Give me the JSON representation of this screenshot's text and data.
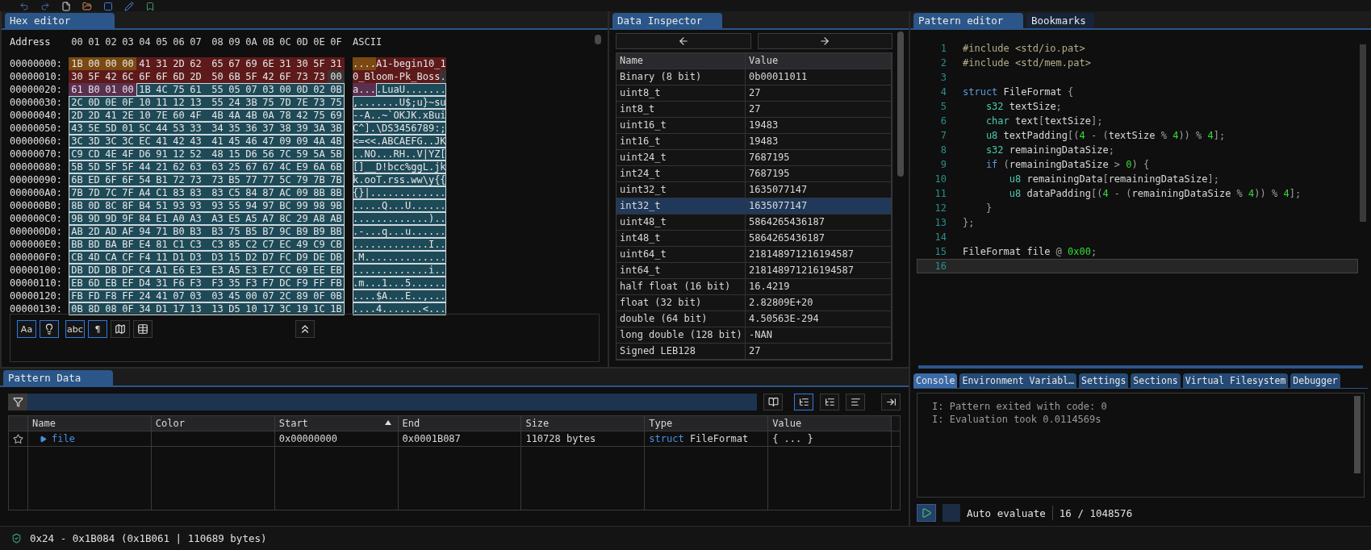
{
  "toolbar": {
    "icons": [
      {
        "kind": "undo"
      },
      {
        "kind": "redo"
      },
      {
        "kind": "file"
      },
      {
        "kind": "folder"
      },
      {
        "kind": "square"
      },
      {
        "kind": "pencil"
      },
      {
        "kind": "bookmark"
      }
    ]
  },
  "hex_editor": {
    "tabs": [
      {
        "label": "Hex editor",
        "selected": true
      }
    ],
    "header": {
      "address": "Address",
      "columns": [
        "00",
        "01",
        "02",
        "03",
        "04",
        "05",
        "06",
        "07",
        "08",
        "09",
        "0A",
        "0B",
        "0C",
        "0D",
        "0E",
        "0F"
      ],
      "ascii": "ASCII"
    },
    "rows": [
      {
        "address": "00000000:",
        "groups": [
          {
            "color": "#7a4a12",
            "selected": false,
            "bytes": [
              "1B",
              "00",
              "00",
              "00"
            ],
            "ascii": "...."
          },
          {
            "color": "#5e1a1a",
            "selected": false,
            "bytes": [
              "41",
              "31",
              "2D",
              "62",
              "65",
              "67",
              "69",
              "6E",
              "31",
              "30",
              "5F",
              "31"
            ],
            "ascii": "A1-begin10_1"
          }
        ]
      },
      {
        "address": "00000010:",
        "groups": [
          {
            "color": "#5e1a1a",
            "selected": false,
            "bytes": [
              "30",
              "5F",
              "42",
              "6C",
              "6F",
              "6F",
              "6D",
              "2D",
              "50",
              "6B",
              "5F",
              "42",
              "6F",
              "73",
              "73"
            ],
            "ascii": "0_Bloom-Pk_Boss"
          },
          {
            "color": "#3a3434",
            "selected": false,
            "bytes": [
              "00"
            ],
            "ascii": "."
          }
        ]
      },
      {
        "address": "00000020:",
        "groups": [
          {
            "color": "#5a3050",
            "selected": false,
            "bytes": [
              "61",
              "B0",
              "01",
              "00"
            ],
            "ascii": "a..."
          },
          {
            "color": "#1e4a58",
            "selected": true,
            "bytes": [
              "1B",
              "4C",
              "75",
              "61",
              "55",
              "05",
              "07",
              "03",
              "00",
              "0D",
              "02",
              "0B"
            ],
            "ascii": ".LuaU......."
          }
        ]
      },
      {
        "address": "00000030:",
        "groups": [
          {
            "color": "#1e4a58",
            "selected": true,
            "bytes": [
              "2C",
              "0D",
              "0E",
              "0F",
              "10",
              "11",
              "12",
              "13",
              "55",
              "24",
              "3B",
              "75",
              "7D",
              "7E",
              "73",
              "75"
            ],
            "ascii": ",.......U$;u}~su"
          }
        ]
      },
      {
        "address": "00000040:",
        "groups": [
          {
            "color": "#1e4a58",
            "selected": true,
            "bytes": [
              "2D",
              "2D",
              "41",
              "2E",
              "10",
              "7E",
              "60",
              "4F",
              "4B",
              "4A",
              "4B",
              "0A",
              "78",
              "42",
              "75",
              "69"
            ],
            "ascii": "--A..~`OKJK.xBui"
          }
        ]
      },
      {
        "address": "00000050:",
        "groups": [
          {
            "color": "#1e4a58",
            "selected": true,
            "bytes": [
              "43",
              "5E",
              "5D",
              "01",
              "5C",
              "44",
              "53",
              "33",
              "34",
              "35",
              "36",
              "37",
              "38",
              "39",
              "3A",
              "3B"
            ],
            "ascii": "C^].\\DS3456789:;"
          }
        ]
      },
      {
        "address": "00000060:",
        "groups": [
          {
            "color": "#1e4a58",
            "selected": true,
            "bytes": [
              "3C",
              "3D",
              "3C",
              "3C",
              "EC",
              "41",
              "42",
              "43",
              "41",
              "45",
              "46",
              "47",
              "09",
              "09",
              "4A",
              "4B"
            ],
            "ascii": "<=<<.ABCAEFG..JK"
          }
        ]
      },
      {
        "address": "00000070:",
        "groups": [
          {
            "color": "#1e4a58",
            "selected": true,
            "bytes": [
              "C9",
              "CD",
              "4E",
              "4F",
              "D6",
              "91",
              "12",
              "52",
              "48",
              "15",
              "D6",
              "56",
              "7C",
              "59",
              "5A",
              "5B"
            ],
            "ascii": "..NO...RH..V|YZ["
          }
        ]
      },
      {
        "address": "00000080:",
        "groups": [
          {
            "color": "#1e4a58",
            "selected": true,
            "bytes": [
              "5B",
              "5D",
              "5F",
              "5F",
              "44",
              "21",
              "62",
              "63",
              "63",
              "25",
              "67",
              "67",
              "4C",
              "E9",
              "6A",
              "6B"
            ],
            "ascii": "[]__D!bcc%ggL.jk"
          }
        ]
      },
      {
        "address": "00000090:",
        "groups": [
          {
            "color": "#1e4a58",
            "selected": true,
            "bytes": [
              "6B",
              "ED",
              "6F",
              "6F",
              "54",
              "B1",
              "72",
              "73",
              "73",
              "B5",
              "77",
              "77",
              "5C",
              "79",
              "7B",
              "7B"
            ],
            "ascii": "k.ooT.rss.ww\\y{{"
          }
        ]
      },
      {
        "address": "000000A0:",
        "groups": [
          {
            "color": "#1e4a58",
            "selected": true,
            "bytes": [
              "7B",
              "7D",
              "7C",
              "7F",
              "A4",
              "C1",
              "83",
              "83",
              "83",
              "C5",
              "84",
              "87",
              "AC",
              "09",
              "8B",
              "8B"
            ],
            "ascii": "{}|............."
          }
        ]
      },
      {
        "address": "000000B0:",
        "groups": [
          {
            "color": "#1e4a58",
            "selected": true,
            "bytes": [
              "8B",
              "0D",
              "8C",
              "8F",
              "B4",
              "51",
              "93",
              "93",
              "93",
              "55",
              "94",
              "97",
              "BC",
              "99",
              "98",
              "9B"
            ],
            "ascii": ".....Q...U......"
          }
        ]
      },
      {
        "address": "000000C0:",
        "groups": [
          {
            "color": "#1e4a58",
            "selected": true,
            "bytes": [
              "9B",
              "9D",
              "9D",
              "9F",
              "84",
              "E1",
              "A0",
              "A3",
              "A3",
              "E5",
              "A5",
              "A7",
              "8C",
              "29",
              "A8",
              "AB"
            ],
            "ascii": ".............).."
          }
        ]
      },
      {
        "address": "000000D0:",
        "groups": [
          {
            "color": "#1e4a58",
            "selected": true,
            "bytes": [
              "AB",
              "2D",
              "AD",
              "AF",
              "94",
              "71",
              "B0",
              "B3",
              "B3",
              "75",
              "B5",
              "B7",
              "9C",
              "B9",
              "B9",
              "BB"
            ],
            "ascii": ".-...q...u......"
          }
        ]
      },
      {
        "address": "000000E0:",
        "groups": [
          {
            "color": "#1e4a58",
            "selected": true,
            "bytes": [
              "BB",
              "BD",
              "BA",
              "BF",
              "E4",
              "81",
              "C1",
              "C3",
              "C3",
              "85",
              "C2",
              "C7",
              "EC",
              "49",
              "C9",
              "CB"
            ],
            "ascii": ".............I.."
          }
        ]
      },
      {
        "address": "000000F0:",
        "groups": [
          {
            "color": "#1e4a58",
            "selected": true,
            "bytes": [
              "CB",
              "4D",
              "CA",
              "CF",
              "F4",
              "11",
              "D1",
              "D3",
              "D3",
              "15",
              "D2",
              "D7",
              "FC",
              "D9",
              "DE",
              "DB"
            ],
            "ascii": ".M.............."
          }
        ]
      },
      {
        "address": "00000100:",
        "groups": [
          {
            "color": "#1e4a58",
            "selected": true,
            "bytes": [
              "DB",
              "DD",
              "DB",
              "DF",
              "C4",
              "A1",
              "E6",
              "E3",
              "E3",
              "A5",
              "E3",
              "E7",
              "CC",
              "69",
              "EE",
              "EB"
            ],
            "ascii": ".............i.."
          }
        ]
      },
      {
        "address": "00000110:",
        "groups": [
          {
            "color": "#1e4a58",
            "selected": true,
            "bytes": [
              "EB",
              "6D",
              "EB",
              "EF",
              "D4",
              "31",
              "F6",
              "F3",
              "F3",
              "35",
              "F3",
              "F7",
              "DC",
              "F9",
              "FF",
              "FB"
            ],
            "ascii": ".m...1...5......"
          }
        ]
      },
      {
        "address": "00000120:",
        "groups": [
          {
            "color": "#1e4a58",
            "selected": true,
            "bytes": [
              "FB",
              "FD",
              "F8",
              "FF",
              "24",
              "41",
              "07",
              "03",
              "03",
              "45",
              "00",
              "07",
              "2C",
              "89",
              "0F",
              "0B"
            ],
            "ascii": "....$A...E..,..."
          }
        ]
      },
      {
        "address": "00000130:",
        "groups": [
          {
            "color": "#1e4a58",
            "selected": true,
            "bytes": [
              "0B",
              "8D",
              "08",
              "0F",
              "34",
              "D1",
              "17",
              "13",
              "13",
              "D5",
              "10",
              "17",
              "3C",
              "19",
              "1C",
              "1B"
            ],
            "ascii": "....4.......<..."
          }
        ]
      }
    ],
    "tools": [
      {
        "kind": "text",
        "label": "Aa",
        "selected": true
      },
      {
        "kind": "bulb",
        "selected": true
      },
      {
        "kind": "text",
        "label": "abc",
        "selected": true
      },
      {
        "kind": "text",
        "label": "¶",
        "selected": true
      },
      {
        "kind": "map",
        "selected": false
      },
      {
        "kind": "table",
        "selected": false
      }
    ]
  },
  "data_inspector": {
    "tabs": [
      {
        "label": "Data Inspector",
        "selected": true
      }
    ],
    "columns": [
      "Name",
      "Value"
    ],
    "rows": [
      {
        "name": "Binary (8 bit)",
        "value": "0b00011011",
        "selected": false
      },
      {
        "name": "uint8_t",
        "value": "27",
        "selected": false
      },
      {
        "name": "int8_t",
        "value": "27",
        "selected": false
      },
      {
        "name": "uint16_t",
        "value": "19483",
        "selected": false
      },
      {
        "name": "int16_t",
        "value": "19483",
        "selected": false
      },
      {
        "name": "uint24_t",
        "value": "7687195",
        "selected": false
      },
      {
        "name": "int24_t",
        "value": "7687195",
        "selected": false
      },
      {
        "name": "uint32_t",
        "value": "1635077147",
        "selected": false
      },
      {
        "name": "int32_t",
        "value": "1635077147",
        "selected": true
      },
      {
        "name": "uint48_t",
        "value": "5864265436187",
        "selected": false
      },
      {
        "name": "int48_t",
        "value": "5864265436187",
        "selected": false
      },
      {
        "name": "uint64_t",
        "value": "218148971216194587",
        "selected": false
      },
      {
        "name": "int64_t",
        "value": "218148971216194587",
        "selected": false
      },
      {
        "name": "half float (16 bit)",
        "value": "16.4219",
        "selected": false
      },
      {
        "name": "float (32 bit)",
        "value": "2.82809E+20",
        "selected": false
      },
      {
        "name": "double (64 bit)",
        "value": "4.50563E-294",
        "selected": false
      },
      {
        "name": "long double (128 bit)",
        "value": "-NAN",
        "selected": false
      },
      {
        "name": "Signed LEB128",
        "value": "27",
        "selected": false
      }
    ]
  },
  "pattern_editor": {
    "tabs": [
      {
        "label": "Pattern editor",
        "selected": true
      },
      {
        "label": "Bookmarks",
        "selected": false
      }
    ],
    "lines": [
      {
        "number": "1",
        "current": false,
        "tokens": [
          {
            "kind": "preproc",
            "text": "#include <std/io.pat>"
          }
        ]
      },
      {
        "number": "2",
        "current": false,
        "tokens": [
          {
            "kind": "preproc",
            "text": "#include <std/mem.pat>"
          }
        ]
      },
      {
        "number": "3",
        "current": false
      },
      {
        "number": "4",
        "current": false,
        "tokens": [
          {
            "kind": "keyword",
            "text": "struct"
          },
          {
            "kind": "plain",
            "text": " FileFormat "
          },
          {
            "kind": "punct",
            "text": "{"
          }
        ]
      },
      {
        "number": "5",
        "current": false,
        "tokens": [
          {
            "kind": "type",
            "text": "    s32"
          },
          {
            "kind": "plain",
            "text": " textSize"
          },
          {
            "kind": "punct",
            "text": ";"
          }
        ]
      },
      {
        "number": "6",
        "current": false,
        "tokens": [
          {
            "kind": "type",
            "text": "    char"
          },
          {
            "kind": "plain",
            "text": " text"
          },
          {
            "kind": "punct",
            "text": "["
          },
          {
            "kind": "plain",
            "text": "textSize"
          },
          {
            "kind": "punct",
            "text": "];"
          }
        ]
      },
      {
        "number": "7",
        "current": false,
        "tokens": [
          {
            "kind": "type",
            "text": "    u8"
          },
          {
            "kind": "plain",
            "text": " textPadding"
          },
          {
            "kind": "punct",
            "text": "[("
          },
          {
            "kind": "number",
            "text": "4"
          },
          {
            "kind": "punct",
            "text": " - ("
          },
          {
            "kind": "plain",
            "text": "textSize"
          },
          {
            "kind": "punct",
            "text": " % "
          },
          {
            "kind": "number",
            "text": "4"
          },
          {
            "kind": "punct",
            "text": ")) % "
          },
          {
            "kind": "number",
            "text": "4"
          },
          {
            "kind": "punct",
            "text": "];"
          }
        ]
      },
      {
        "number": "8",
        "current": false,
        "tokens": [
          {
            "kind": "type",
            "text": "    s32"
          },
          {
            "kind": "plain",
            "text": " remainingDataSize"
          },
          {
            "kind": "punct",
            "text": ";"
          }
        ]
      },
      {
        "number": "9",
        "current": false,
        "tokens": [
          {
            "kind": "keyword",
            "text": "    if"
          },
          {
            "kind": "punct",
            "text": " ("
          },
          {
            "kind": "plain",
            "text": "remainingDataSize"
          },
          {
            "kind": "punct",
            "text": " > "
          },
          {
            "kind": "number",
            "text": "0"
          },
          {
            "kind": "punct",
            "text": ") {"
          }
        ]
      },
      {
        "number": "10",
        "current": false,
        "tokens": [
          {
            "kind": "type",
            "text": "        u8"
          },
          {
            "kind": "plain",
            "text": " remainingData"
          },
          {
            "kind": "punct",
            "text": "["
          },
          {
            "kind": "plain",
            "text": "remainingDataSize"
          },
          {
            "kind": "punct",
            "text": "];"
          }
        ]
      },
      {
        "number": "11",
        "current": false,
        "tokens": [
          {
            "kind": "type",
            "text": "        u8"
          },
          {
            "kind": "plain",
            "text": " dataPadding"
          },
          {
            "kind": "punct",
            "text": "[("
          },
          {
            "kind": "number",
            "text": "4"
          },
          {
            "kind": "punct",
            "text": " - ("
          },
          {
            "kind": "plain",
            "text": "remainingDataSize"
          },
          {
            "kind": "punct",
            "text": " % "
          },
          {
            "kind": "number",
            "text": "4"
          },
          {
            "kind": "punct",
            "text": ")) % "
          },
          {
            "kind": "number",
            "text": "4"
          },
          {
            "kind": "punct",
            "text": "];"
          }
        ]
      },
      {
        "number": "12",
        "current": false,
        "tokens": [
          {
            "kind": "punct",
            "text": "    }"
          }
        ]
      },
      {
        "number": "13",
        "current": false,
        "tokens": [
          {
            "kind": "punct",
            "text": "};"
          }
        ]
      },
      {
        "number": "14",
        "current": false
      },
      {
        "number": "15",
        "current": false,
        "tokens": [
          {
            "kind": "plain",
            "text": "FileFormat file "
          },
          {
            "kind": "punct",
            "text": "@ "
          },
          {
            "kind": "number",
            "text": "0x00"
          },
          {
            "kind": "punct",
            "text": ";"
          }
        ]
      },
      {
        "number": "16",
        "current": true
      }
    ]
  },
  "console": {
    "tabs": [
      {
        "label": "Console",
        "selected": true
      },
      {
        "label": "Environment Variabl…",
        "selected": false
      },
      {
        "label": "Settings",
        "selected": false
      },
      {
        "label": "Sections",
        "selected": false
      },
      {
        "label": "Virtual Filesystem",
        "selected": false
      },
      {
        "label": "Debugger",
        "selected": false
      }
    ],
    "lines": [
      "I: Pattern exited with code: 0",
      "I: Evaluation took 0.0114569s"
    ],
    "auto_evaluate": {
      "label": "Auto evaluate",
      "checked": false
    },
    "position": "16 / 1048576"
  },
  "pattern_data": {
    "tabs": [
      {
        "label": "Pattern Data",
        "selected": true
      }
    ],
    "view_buttons": [
      {
        "kind": "book",
        "selected": false
      },
      {
        "kind": "tree",
        "selected": true
      },
      {
        "kind": "tree",
        "selected": false
      },
      {
        "kind": "lines",
        "selected": false
      }
    ],
    "columns": [
      {
        "label": "Name",
        "sorted": false
      },
      {
        "label": "Color",
        "sorted": false
      },
      {
        "label": "Start",
        "sorted": true
      },
      {
        "label": "End",
        "sorted": false
      },
      {
        "label": "Size",
        "sorted": false
      },
      {
        "label": "Type",
        "sorted": false
      },
      {
        "label": "Value",
        "sorted": false
      }
    ],
    "rows": [
      {
        "name": "file",
        "expanded": false,
        "start": "0x00000000",
        "end": "0x0001B087",
        "size": "110728 bytes",
        "type_keyword": "struct",
        "type_name": "FileFormat",
        "value": "{ ... }"
      }
    ]
  },
  "status_bar": {
    "selection": "0x24 - 0x1B084 (0x1B061 | 110689 bytes)"
  }
}
